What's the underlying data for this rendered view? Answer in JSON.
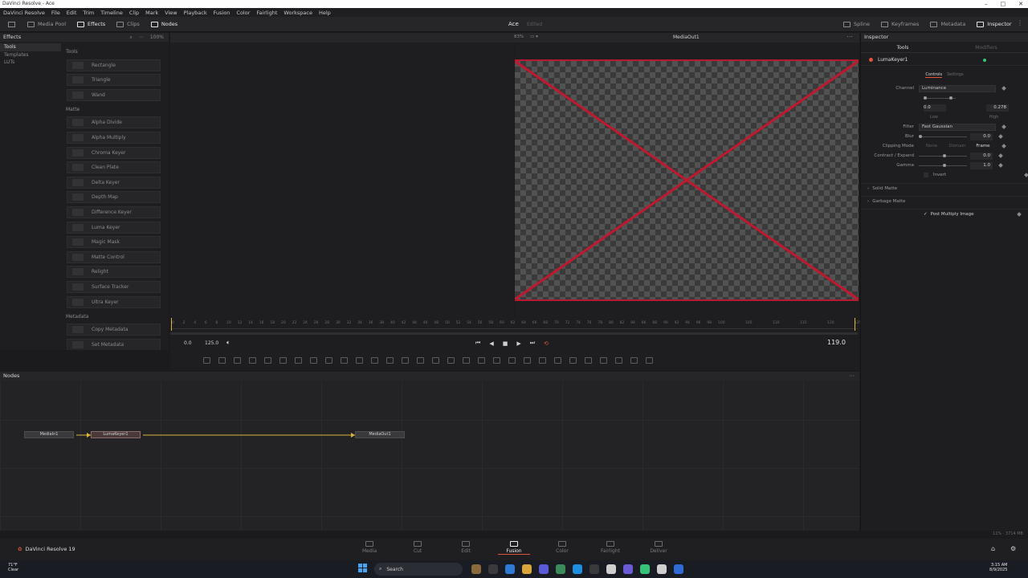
{
  "window": {
    "title": "DaVinci Resolve - Ace",
    "controls": [
      "–",
      "□",
      "✕"
    ]
  },
  "menu": [
    "DaVinci Resolve",
    "File",
    "Edit",
    "Trim",
    "Timeline",
    "Clip",
    "Mark",
    "View",
    "Playback",
    "Fusion",
    "Color",
    "Fairlight",
    "Workspace",
    "Help"
  ],
  "toolbar": {
    "left": [
      {
        "label": "Media Pool",
        "icon": "media-pool-icon",
        "active": false
      },
      {
        "label": "Effects",
        "icon": "effects-icon",
        "active": true
      },
      {
        "label": "Clips",
        "icon": "clips-icon",
        "active": false
      },
      {
        "label": "Nodes",
        "icon": "nodes-icon",
        "active": true
      }
    ],
    "project": "Ace",
    "project_status": "Edited",
    "right": [
      {
        "label": "Spline",
        "icon": "spline-icon",
        "active": false
      },
      {
        "label": "Keyframes",
        "icon": "keyframes-icon",
        "active": false
      },
      {
        "label": "Metadata",
        "icon": "metadata-icon",
        "active": false
      },
      {
        "label": "Inspector",
        "icon": "inspector-icon",
        "active": true
      }
    ]
  },
  "effects": {
    "title": "Effects",
    "zoom": "100%",
    "sidebar": [
      "Tools",
      "Templates",
      "LUTs"
    ],
    "groups": [
      {
        "name": "Tools",
        "items": [
          "Rectangle",
          "Triangle",
          "Wand"
        ]
      },
      {
        "name": "Matte",
        "items": [
          "Alpha Divide",
          "Alpha Multiply",
          "Chroma Keyer",
          "Clean Plate",
          "Delta Keyer",
          "Depth Map",
          "Difference Keyer",
          "Luma Keyer",
          "Magic Mask",
          "Matte Control",
          "Relight",
          "Surface Tracker",
          "Ultra Keyer"
        ]
      },
      {
        "name": "Metadata",
        "items": [
          "Copy Metadata",
          "Set Metadata"
        ]
      }
    ]
  },
  "viewer": {
    "zoom": "83%",
    "title": "MediaOut1",
    "ruler_ticks": [
      "0",
      "2",
      "4",
      "6",
      "8",
      "10",
      "12",
      "14",
      "16",
      "18",
      "20",
      "22",
      "24",
      "26",
      "28",
      "30",
      "32",
      "34",
      "36",
      "38",
      "40",
      "42",
      "44",
      "46",
      "48",
      "50",
      "52",
      "54",
      "56",
      "58",
      "60",
      "62",
      "64",
      "66",
      "68",
      "70",
      "72",
      "74",
      "76",
      "78",
      "80",
      "82",
      "84",
      "86",
      "88",
      "90",
      "92",
      "94",
      "96",
      "98",
      "100",
      "105",
      "110",
      "115",
      "120",
      "125"
    ],
    "start": "0.0",
    "end": "125.0",
    "current": "119.0"
  },
  "inspector": {
    "title": "Inspector",
    "tabs": [
      "Tools",
      "Modifiers"
    ],
    "node_name": "LumaKeyer1",
    "subtabs": [
      "Controls",
      "Settings"
    ],
    "channel_label": "Channel",
    "channel_value": "Luminance",
    "low_value": "0.0",
    "high_value": "0.278",
    "low_label": "Low",
    "high_label": "High",
    "filter_label": "Filter",
    "filter_value": "Fast Gaussian",
    "blur_label": "Blur",
    "blur_value": "0.0",
    "clipping_label": "Clipping Mode",
    "clipping_options": [
      "None",
      "Domain",
      "Frame"
    ],
    "contract_label": "Contract / Expand",
    "contract_value": "0.0",
    "gamma_label": "Gamma",
    "gamma_value": "1.0",
    "invert_label": "Invert",
    "sections": [
      "Solid Matte",
      "Garbage Matte"
    ],
    "post_multiply_label": "Post Multiply Image"
  },
  "nodes": {
    "title": "Nodes",
    "items": [
      "MediaIn1",
      "LumaKeyer1",
      "MediaOut1"
    ]
  },
  "status": {
    "text": "11% · 3714 MB"
  },
  "pages": [
    {
      "label": "Media",
      "active": false
    },
    {
      "label": "Cut",
      "active": false
    },
    {
      "label": "Edit",
      "active": false
    },
    {
      "label": "Fusion",
      "active": true
    },
    {
      "label": "Color",
      "active": false
    },
    {
      "label": "Fairlight",
      "active": false
    },
    {
      "label": "Deliver",
      "active": false
    }
  ],
  "brand": "DaVinci Resolve 19",
  "taskbar": {
    "weather_temp": "71°F",
    "weather_text": "Clear",
    "search_placeholder": "Search",
    "time": "3:15 AM",
    "date": "8/9/2025"
  },
  "colors": {
    "accent": "#e0533c",
    "viewer_border": "#b8192f",
    "connection": "#d9b43a"
  }
}
